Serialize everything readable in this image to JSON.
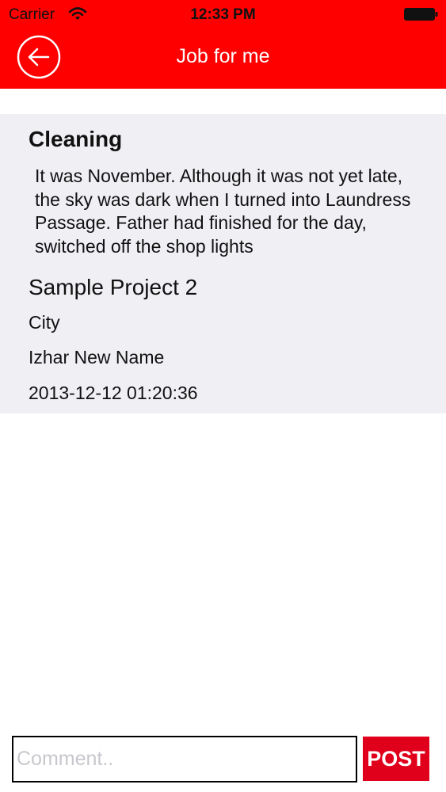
{
  "status_bar": {
    "carrier": "Carrier",
    "time": "12:33 PM",
    "wifi_icon": "wifi-icon",
    "battery_icon": "battery-full-icon"
  },
  "nav": {
    "back_icon": "back-arrow-circle-icon",
    "title": "Job for me"
  },
  "job": {
    "title": "Cleaning",
    "description": "It was November. Although it was not yet late, the sky was dark when I turned into Laundress Passage. Father had finished for the day, switched off the shop lights",
    "project": "Sample Project 2",
    "city": "City",
    "owner": "Izhar New Name",
    "timestamp": "2013-12-12 01:20:36"
  },
  "comment": {
    "placeholder": "Comment..",
    "value": "",
    "post_label": "POST"
  },
  "colors": {
    "header_bg": "#fe0000",
    "card_bg": "#efeff4",
    "post_button_bg": "#e0001b",
    "text": "#111111",
    "placeholder": "#c7c7cd"
  }
}
